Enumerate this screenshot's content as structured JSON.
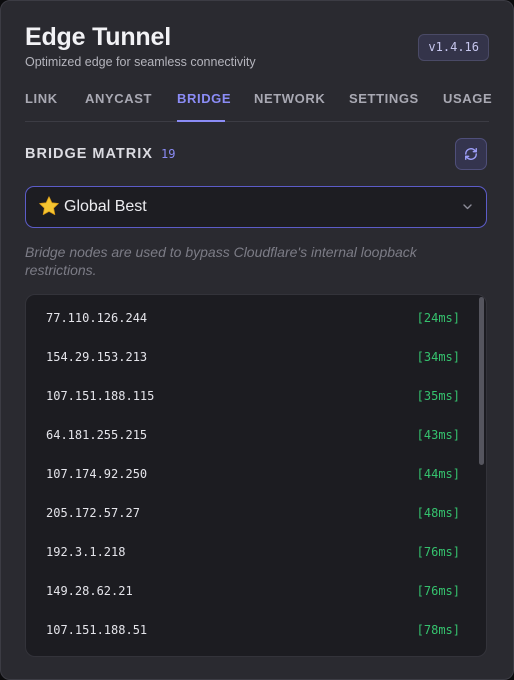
{
  "app": {
    "title": "Edge Tunnel",
    "subtitle": "Optimized edge for seamless connectivity",
    "version": "v1.4.16"
  },
  "tabs": [
    {
      "label": "LINK",
      "active": false
    },
    {
      "label": "ANYCAST",
      "active": false
    },
    {
      "label": "BRIDGE",
      "active": true
    },
    {
      "label": "NETWORK",
      "active": false
    },
    {
      "label": "SETTINGS",
      "active": false
    },
    {
      "label": "USAGE",
      "active": false
    }
  ],
  "section": {
    "title": "BRIDGE MATRIX",
    "count": "19",
    "refresh_icon": "refresh-icon"
  },
  "region_select": {
    "icon": "star-icon",
    "value": "Global Best"
  },
  "note": "Bridge nodes are used to bypass Cloudflare's internal loopback restrictions.",
  "bridges": [
    {
      "ip": "77.110.126.244",
      "latency": "[24ms]"
    },
    {
      "ip": "154.29.153.213",
      "latency": "[34ms]"
    },
    {
      "ip": "107.151.188.115",
      "latency": "[35ms]"
    },
    {
      "ip": "64.181.255.215",
      "latency": "[43ms]"
    },
    {
      "ip": "107.174.92.250",
      "latency": "[44ms]"
    },
    {
      "ip": "205.172.57.27",
      "latency": "[48ms]"
    },
    {
      "ip": "192.3.1.218",
      "latency": "[76ms]"
    },
    {
      "ip": "149.28.62.21",
      "latency": "[76ms]"
    },
    {
      "ip": "107.151.188.51",
      "latency": "[78ms]"
    }
  ],
  "colors": {
    "accent": "#8b8cf6",
    "latency_good": "#35c26e",
    "panel": "#2a2a30"
  }
}
